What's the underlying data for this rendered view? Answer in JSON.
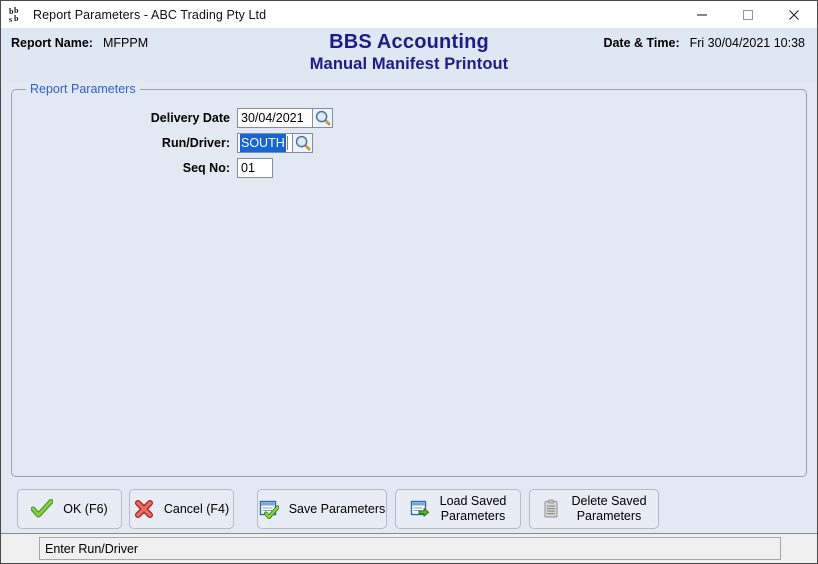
{
  "window": {
    "title": "Report Parameters - ABC Trading Pty Ltd",
    "app_icon": "bbs-logo-icon",
    "controls": {
      "minimize": "minimize-icon",
      "maximize": "maximize-icon",
      "close": "close-icon"
    }
  },
  "header": {
    "report_name_label": "Report Name:",
    "report_name_value": "MFPPM",
    "app_title": "BBS Accounting",
    "report_title": "Manual Manifest Printout",
    "datetime_label": "Date & Time:",
    "datetime_value": "Fri 30/04/2021 10:38",
    "title_color": "#1b1b8f"
  },
  "groupbox": {
    "legend": "Report Parameters",
    "legend_color": "#2b62d0"
  },
  "form": {
    "fields": [
      {
        "label": "Delivery Date",
        "value": "30/04/2021",
        "has_lookup": true,
        "lookup_icon": "magnifier-icon",
        "selected": false,
        "width_class": "w-date"
      },
      {
        "label": "Run/Driver:",
        "value": "SOUTH",
        "has_lookup": true,
        "lookup_icon": "magnifier-icon",
        "selected": true,
        "width_class": "w-run"
      },
      {
        "label": "Seq No:",
        "value": "01",
        "has_lookup": false,
        "lookup_icon": "",
        "selected": false,
        "width_class": "w-seq"
      }
    ]
  },
  "buttons": [
    {
      "label": "OK (F6)",
      "icon": "green-check-icon",
      "enabled": true
    },
    {
      "label": "Cancel (F4)",
      "icon": "red-x-icon",
      "enabled": true
    },
    {
      "label": "Save Parameters",
      "icon": "save-form-icon",
      "enabled": true
    },
    {
      "label": "Load Saved\nParameters",
      "icon": "load-form-icon",
      "enabled": true
    },
    {
      "label": "Delete Saved\nParameters",
      "icon": "delete-clipboard-icon",
      "enabled": false
    }
  ],
  "statusbar": {
    "message": "Enter Run/Driver"
  }
}
